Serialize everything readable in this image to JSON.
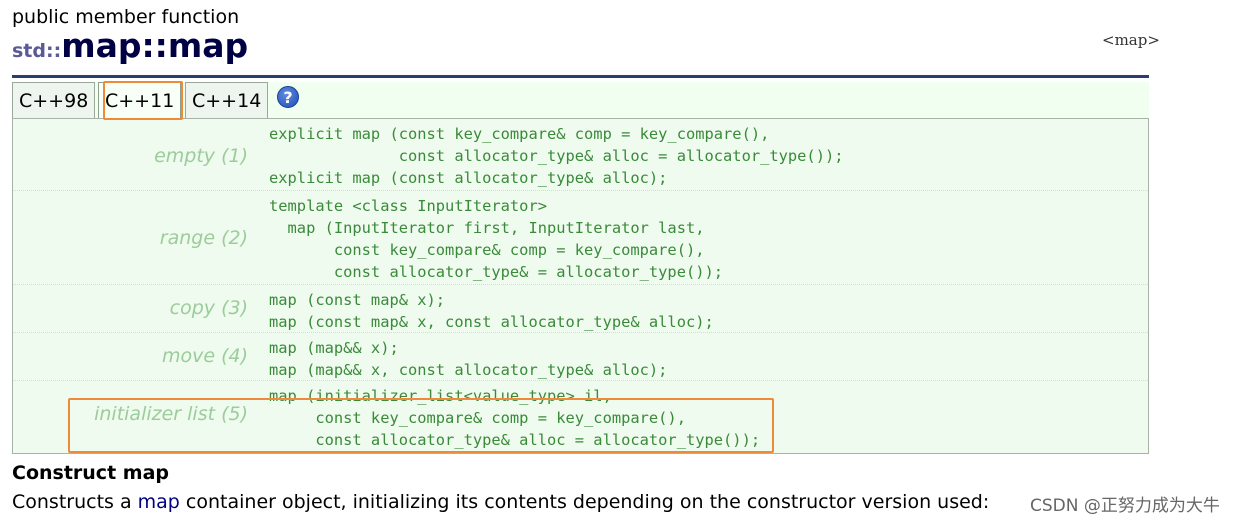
{
  "page": {
    "kind": "public member function",
    "namespace": "std::",
    "name": "map::map",
    "header_tag": "<map>"
  },
  "tabs": [
    {
      "label": "C++98",
      "active": false
    },
    {
      "label": "C++11",
      "active": true
    },
    {
      "label": "C++14",
      "active": false
    }
  ],
  "help": {
    "glyph": "?",
    "icon": "help-icon"
  },
  "prototypes": [
    {
      "label": "empty (1)",
      "lines": [
        "explicit map (const key_compare& comp = key_compare(),",
        "              const allocator_type& alloc = allocator_type());",
        "explicit map (const allocator_type& alloc);"
      ]
    },
    {
      "label": "range (2)",
      "lines": [
        "template <class InputIterator>",
        "  map (InputIterator first, InputIterator last,",
        "       const key_compare& comp = key_compare(),",
        "       const allocator_type& = allocator_type());"
      ]
    },
    {
      "label": "copy (3)",
      "lines": [
        "map (const map& x);",
        "map (const map& x, const allocator_type& alloc);"
      ]
    },
    {
      "label": "move (4)",
      "lines": [
        "map (map&& x);",
        "map (map&& x, const allocator_type& alloc);"
      ]
    },
    {
      "label": "initializer list (5)",
      "lines": [
        "map (initializer_list<value_type> il,",
        "     const key_compare& comp = key_compare(),",
        "     const allocator_type& alloc = allocator_type());"
      ]
    }
  ],
  "section": {
    "title": "Construct map"
  },
  "description": {
    "before": "Constructs a ",
    "link": "map",
    "after": " container object, initializing its contents depending on the constructor version used:"
  },
  "watermark": "CSDN @正努力成为大牛",
  "colors": {
    "highlight": "#ee8a3a",
    "code": "#3a8a3a",
    "label": "#9ccc9c",
    "title": "#000045"
  }
}
